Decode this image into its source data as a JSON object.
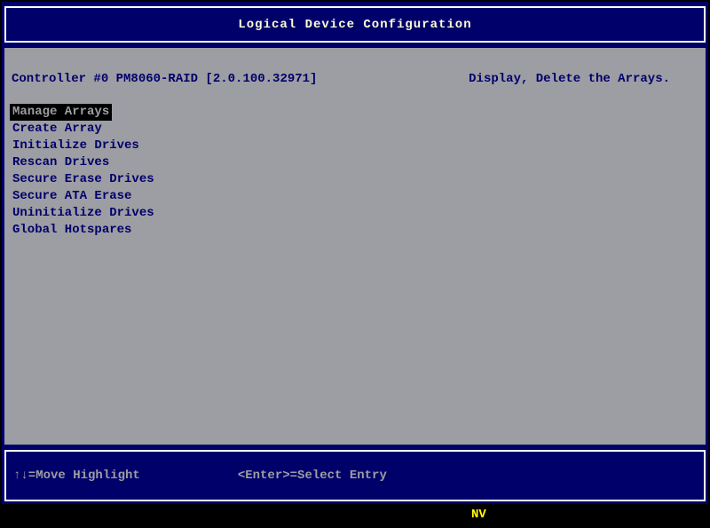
{
  "title": "Logical Device Configuration",
  "main": {
    "controller_info": "Controller #0 PM8060-RAID [2.0.100.32971]",
    "context_help": "Display, Delete the Arrays.",
    "selected_index": 0,
    "menu": [
      "Manage Arrays",
      "Create Array",
      "Initialize Drives",
      "Rescan Drives",
      "Secure Erase Drives",
      "Secure ATA Erase",
      "Uninitialize Drives",
      "Global Hotspares"
    ]
  },
  "footer": {
    "move_hint": "↑↓=Move Highlight",
    "select_hint": "<Enter>=Select Entry"
  },
  "status": {
    "label": "NV"
  },
  "colors": {
    "frame_navy": "#00006a",
    "panel_gray": "#9d9da4",
    "highlight_bg": "#000000",
    "title_text": "#fdfdd8",
    "status_text": "#ffff00",
    "border_white": "#ffffff"
  }
}
